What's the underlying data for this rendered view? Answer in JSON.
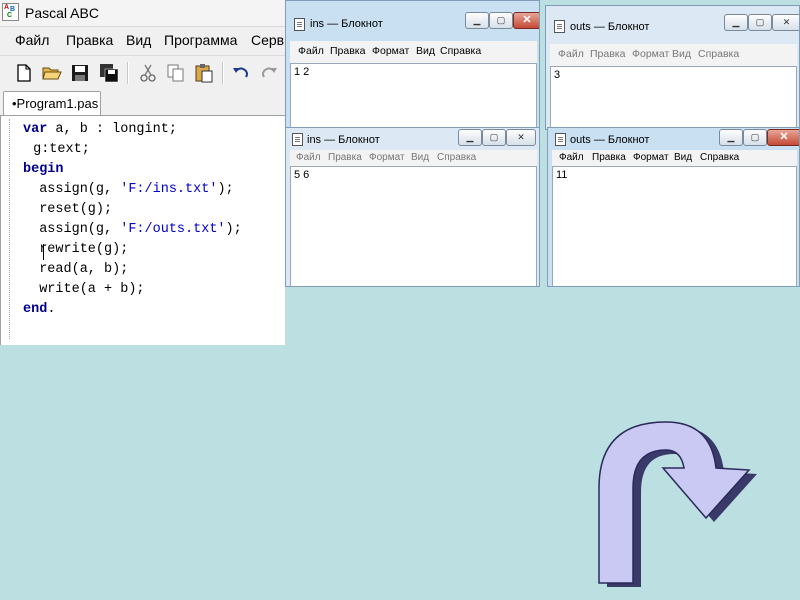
{
  "ide": {
    "title": "Pascal ABC",
    "icon_letters": [
      "A",
      "B",
      "C"
    ],
    "menu": [
      "Файл",
      "Правка",
      "Вид",
      "Программа",
      "Серв"
    ],
    "tab_label": "•Program1.pas",
    "code": [
      [
        {
          "t": "var",
          "c": "kw"
        },
        {
          "t": " a, b : longint;",
          "c": ""
        }
      ],
      [
        {
          "t": " g:text;",
          "c": ""
        }
      ],
      [
        {
          "t": "begin",
          "c": "kw"
        }
      ],
      [
        {
          "t": "  assign(g, ",
          "c": ""
        },
        {
          "t": "'F:/ins.txt'",
          "c": "str"
        },
        {
          "t": ");",
          "c": ""
        }
      ],
      [
        {
          "t": "  reset(g);",
          "c": ""
        }
      ],
      [
        {
          "t": "  assign(g, ",
          "c": ""
        },
        {
          "t": "'F:/outs.txt'",
          "c": "str"
        },
        {
          "t": ");",
          "c": ""
        }
      ],
      [
        {
          "t": "  rewrite(g);",
          "c": ""
        }
      ],
      [
        {
          "t": "  read(a, b);",
          "c": ""
        }
      ],
      [
        {
          "t": "  write(a + b);",
          "c": ""
        }
      ],
      [
        {
          "t": "end",
          "c": "kw"
        },
        {
          "t": ".",
          "c": ""
        }
      ]
    ]
  },
  "notepads": [
    {
      "id": "ins-top",
      "title": "ins — Блокнот",
      "menu": [
        "Файл",
        "Правка",
        "Формат",
        "Вид",
        "Справка"
      ],
      "content": "1 2",
      "active": true
    },
    {
      "id": "outs-top",
      "title": "outs — Блокнот",
      "menu": [
        "Файл",
        "Правка",
        "Формат",
        "Вид",
        "Справка"
      ],
      "content": "3",
      "active": false
    },
    {
      "id": "ins-bottom",
      "title": "ins — Блокнот",
      "menu": [
        "Файл",
        "Правка",
        "Формат",
        "Вид",
        "Справка"
      ],
      "content": "5 6",
      "active": false
    },
    {
      "id": "outs-bottom",
      "title": "outs — Блокнот",
      "menu": [
        "Файл",
        "Правка",
        "Формат",
        "Вид",
        "Справка"
      ],
      "content": "11",
      "active": true
    }
  ],
  "colors": {
    "background": "#bcdfe2",
    "arrow_fill": "#c9c9f3",
    "arrow_outline": "#2a2a5a"
  }
}
